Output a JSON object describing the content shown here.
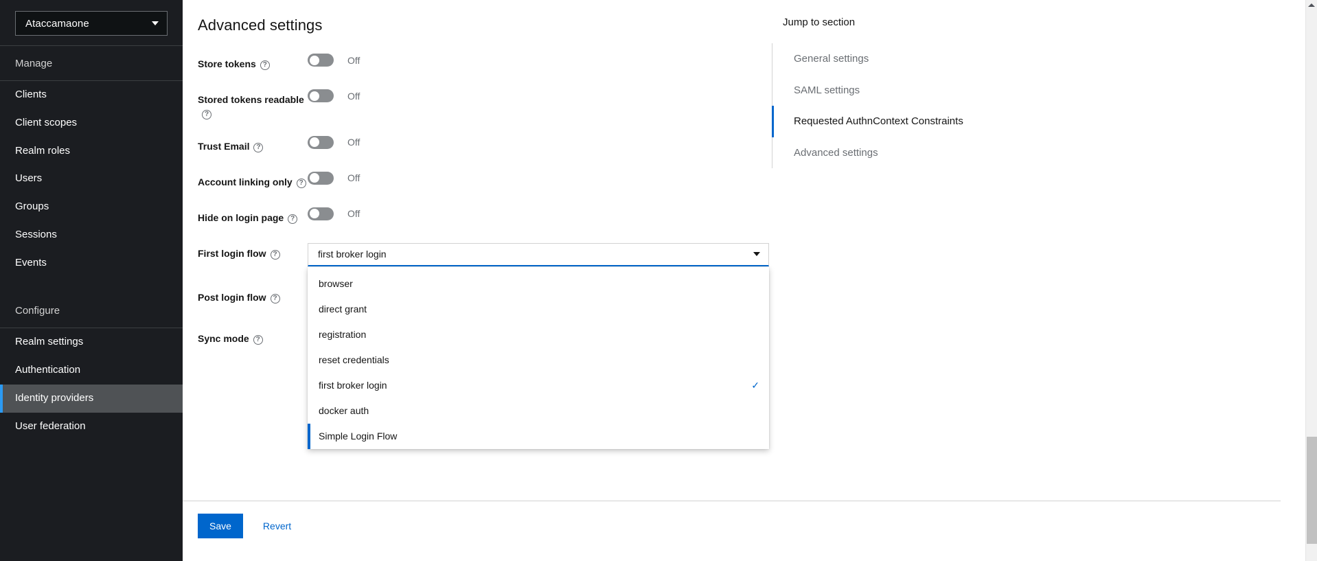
{
  "sidebar": {
    "realm_selector": {
      "label": "Ataccamaone",
      "caret_icon": "chevron-down-icon"
    },
    "groups": [
      {
        "title": "Manage",
        "items": [
          {
            "label": "Clients",
            "active": false
          },
          {
            "label": "Client scopes",
            "active": false
          },
          {
            "label": "Realm roles",
            "active": false
          },
          {
            "label": "Users",
            "active": false
          },
          {
            "label": "Groups",
            "active": false
          },
          {
            "label": "Sessions",
            "active": false
          },
          {
            "label": "Events",
            "active": false
          }
        ]
      },
      {
        "title": "Configure",
        "items": [
          {
            "label": "Realm settings",
            "active": false
          },
          {
            "label": "Authentication",
            "active": false
          },
          {
            "label": "Identity providers",
            "active": true
          },
          {
            "label": "User federation",
            "active": false
          }
        ]
      }
    ]
  },
  "main": {
    "page_title": "Advanced settings",
    "help_icon_glyph": "?",
    "switch_rows": [
      {
        "label": "Store tokens",
        "state": "Off",
        "checked": false
      },
      {
        "label": "Stored tokens readable",
        "state": "Off",
        "checked": false
      },
      {
        "label": "Trust Email",
        "state": "Off",
        "checked": false
      },
      {
        "label": "Account linking only",
        "state": "Off",
        "checked": false
      },
      {
        "label": "Hide on login page",
        "state": "Off",
        "checked": false
      }
    ],
    "select_rows": [
      {
        "label": "First login flow",
        "value": "first broker login",
        "open": true
      },
      {
        "label": "Post login flow",
        "value": "",
        "open": false
      },
      {
        "label": "Sync mode",
        "value": "",
        "open": false
      }
    ],
    "first_login_flow": {
      "label": "First login flow",
      "value": "first broker login",
      "caret_icon": "caret-down-icon",
      "check_icon": "check-icon",
      "options": [
        {
          "label": "browser",
          "selected": false,
          "focused": false
        },
        {
          "label": "direct grant",
          "selected": false,
          "focused": false
        },
        {
          "label": "registration",
          "selected": false,
          "focused": false
        },
        {
          "label": "reset credentials",
          "selected": false,
          "focused": false
        },
        {
          "label": "first broker login",
          "selected": true,
          "focused": false
        },
        {
          "label": "docker auth",
          "selected": false,
          "focused": false
        },
        {
          "label": "Simple Login Flow",
          "selected": false,
          "focused": true
        }
      ]
    },
    "post_login_flow_label": "Post login flow",
    "sync_mode_label": "Sync mode",
    "actions": {
      "save_label": "Save",
      "revert_label": "Revert"
    }
  },
  "jump_to_section": {
    "title": "Jump to section",
    "items": [
      {
        "label": "General settings",
        "active": false
      },
      {
        "label": "SAML settings",
        "active": false
      },
      {
        "label": "Requested AuthnContext Constraints",
        "active": true
      },
      {
        "label": "Advanced settings",
        "active": false
      }
    ]
  },
  "scrollbar": {
    "arrow_up_icon": "triangle-up-icon"
  },
  "colors": {
    "accent_blue": "#06c",
    "sidebar_bg": "#1b1d21",
    "active_nav_bg": "#4f5255",
    "nav_accent": "#2b9af3",
    "switch_off": "#8a8d90",
    "muted_text": "#6a6e73"
  }
}
